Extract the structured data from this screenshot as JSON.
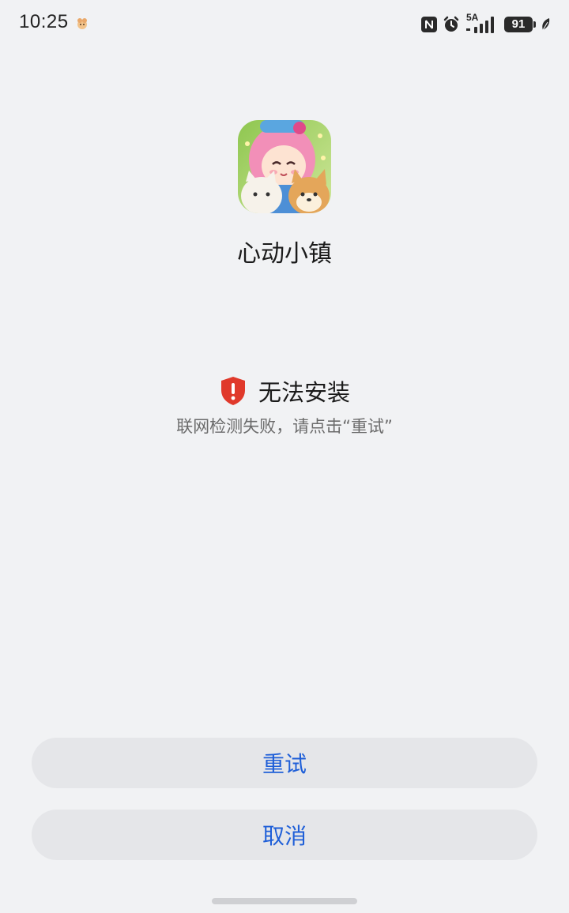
{
  "status_bar": {
    "time": "10:25",
    "network_type": "5A",
    "battery_level": "91",
    "icons": [
      "app-notification-icon",
      "nfc-icon",
      "alarm-icon",
      "signal-icon",
      "battery-icon",
      "leaf-icon"
    ]
  },
  "app": {
    "name": "心动小镇",
    "icon": "app-icon"
  },
  "error": {
    "icon": "shield-alert-icon",
    "title": "无法安装",
    "description": "联网检测失败，请点击“重试”"
  },
  "buttons": {
    "retry_label": "重试",
    "cancel_label": "取消"
  },
  "colors": {
    "background": "#f1f2f4",
    "button_bg": "#e5e6e9",
    "button_text": "#1f5fd8",
    "shield": "#e0392b"
  }
}
